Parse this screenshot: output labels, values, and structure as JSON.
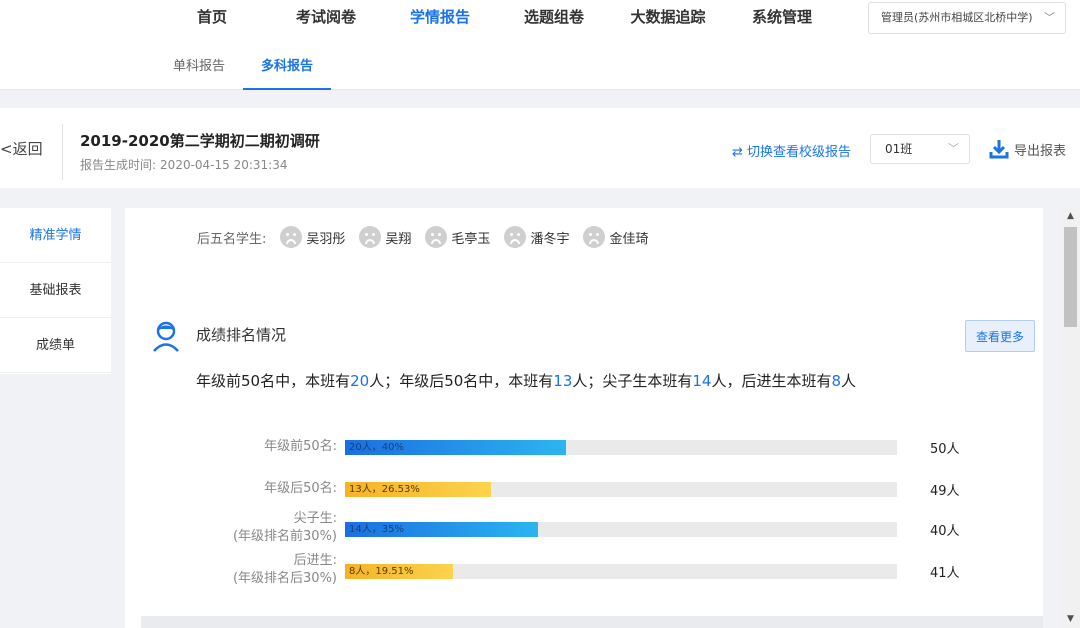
{
  "nav": {
    "items": [
      {
        "label": "首页"
      },
      {
        "label": "考试阅卷"
      },
      {
        "label": "学情报告"
      },
      {
        "label": "选题组卷"
      },
      {
        "label": "大数据追踪"
      },
      {
        "label": "系统管理"
      }
    ],
    "active_index": 2,
    "user": "管理员(苏州市相城区北桥中学)"
  },
  "subnav": {
    "items": [
      {
        "label": "单科报告"
      },
      {
        "label": "多科报告"
      }
    ],
    "active_index": 1
  },
  "header": {
    "back_label": "返回",
    "title": "2019-2020第二学期初二期初调研",
    "gen_time_label": "报告生成时间:",
    "gen_time_value": "2020-04-15 20:31:34",
    "switch_label": "⇄ 切换查看校级报告",
    "class_value": "01班",
    "export_label": "导出报表"
  },
  "side": {
    "items": [
      {
        "label": "精准学情"
      },
      {
        "label": "基础报表"
      },
      {
        "label": "成绩单"
      }
    ],
    "active_index": 0
  },
  "bottom5": {
    "label": "后五名学生:",
    "students": [
      "吴羽彤",
      "吴翔",
      "毛亭玉",
      "潘冬宇",
      "金佳琦"
    ]
  },
  "ranking": {
    "title": "成绩排名情况",
    "more_label": "查看更多",
    "summary": {
      "p1": "年级前50名中，本班有",
      "n1": "20",
      "p2": "人；年级后50名中，本班有",
      "n2": "13",
      "p3": "人；尖子生本班有",
      "n3": "14",
      "p4": "人，后进生本班有",
      "n4": "8",
      "p5": "人"
    },
    "bars": [
      {
        "label": "年级前50名:",
        "sub": "",
        "count": 20,
        "percent": 40,
        "bar_text": "20人，40%",
        "total": "50人",
        "color": "blue"
      },
      {
        "label": "年级后50名:",
        "sub": "",
        "count": 13,
        "percent": 26.53,
        "bar_text": "13人，26.53%",
        "total": "49人",
        "color": "yellow"
      },
      {
        "label": "尖子生:",
        "sub": "(年级排名前30%)",
        "count": 14,
        "percent": 35,
        "bar_text": "14人，35%",
        "total": "40人",
        "color": "blue"
      },
      {
        "label": "后进生:",
        "sub": "(年级排名后30%)",
        "count": 8,
        "percent": 19.51,
        "bar_text": "8人，19.51%",
        "total": "41人",
        "color": "yellow"
      }
    ]
  },
  "colors": {
    "accent": "#1a73e8",
    "bar_blue": "#1a6fe0",
    "bar_yellow": "#f5b227"
  }
}
